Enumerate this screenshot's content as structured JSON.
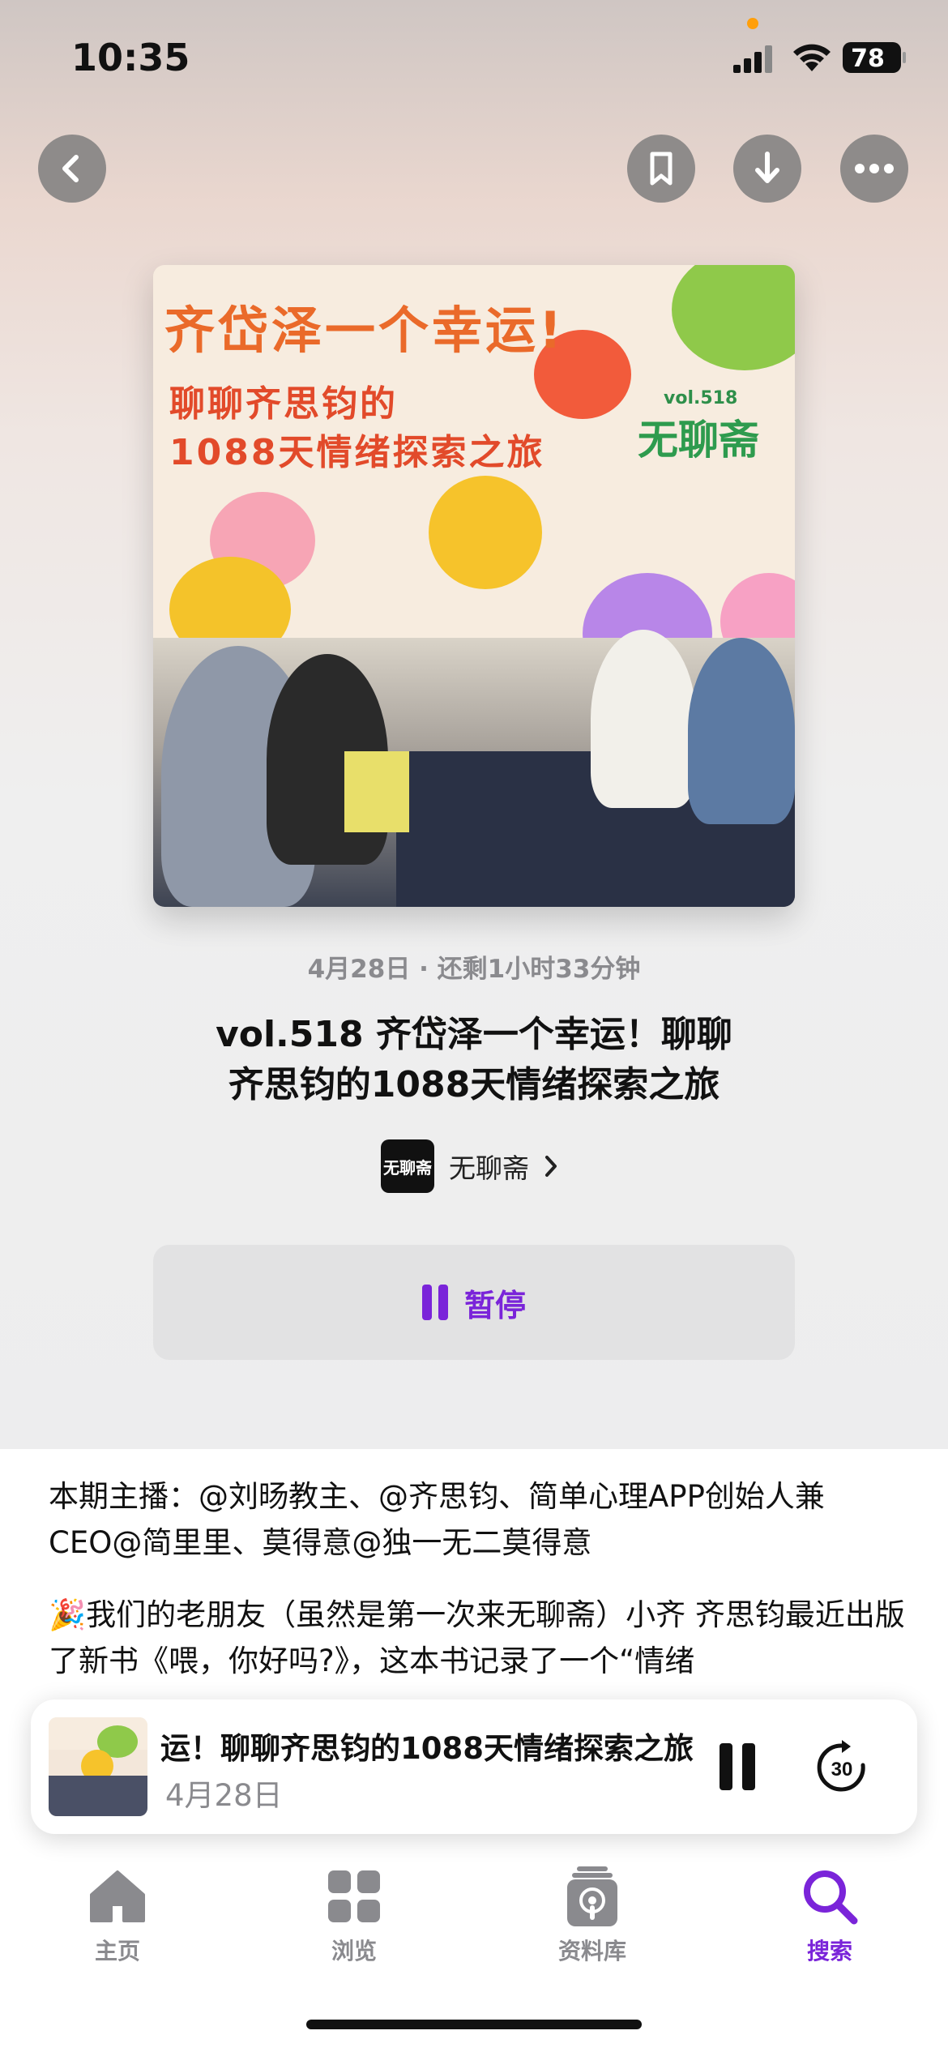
{
  "status": {
    "time": "10:35",
    "battery": "78"
  },
  "nav": {
    "back": "back",
    "save": "bookmark",
    "download": "download",
    "more": "more"
  },
  "artwork": {
    "line1": "齐岱泽一个幸运!",
    "line2": "聊聊齐思钧的",
    "line3": "1088天情绪探索之旅",
    "vol": "vol.518",
    "logo": "无聊斋"
  },
  "episode": {
    "meta": "4月28日 · 还剩1小时33分钟",
    "title_line1": "vol.518 齐岱泽一个幸运！聊聊",
    "title_line2": "齐思钧的1088天情绪探索之旅",
    "show_logo": "无聊斋",
    "show_name": "无聊斋"
  },
  "actions": {
    "pause_label": "暂停"
  },
  "description": {
    "p1": "本期主播：@刘旸教主、@齐思钧、简单心理APP创始人兼CEO@简里里、莫得意@独一无二莫得意",
    "p2": "🎉我们的老朋友（虽然是第一次来无聊斋）小齐 齐思钧最近出版了新书《喂，你好吗?》，这本书记录了一个“情绪"
  },
  "mini_player": {
    "title": "运！聊聊齐思钧的1088天情绪探索之旅",
    "date": "4月28日",
    "skip_seconds": "30"
  },
  "tabs": [
    {
      "label": "主页",
      "icon": "home-icon"
    },
    {
      "label": "浏览",
      "icon": "browse-grid-icon"
    },
    {
      "label": "资料库",
      "icon": "library-icon"
    },
    {
      "label": "搜索",
      "icon": "search-icon",
      "active": true
    }
  ],
  "colors": {
    "accent": "#7a24d9",
    "tab_inactive": "#8a8a8e"
  }
}
